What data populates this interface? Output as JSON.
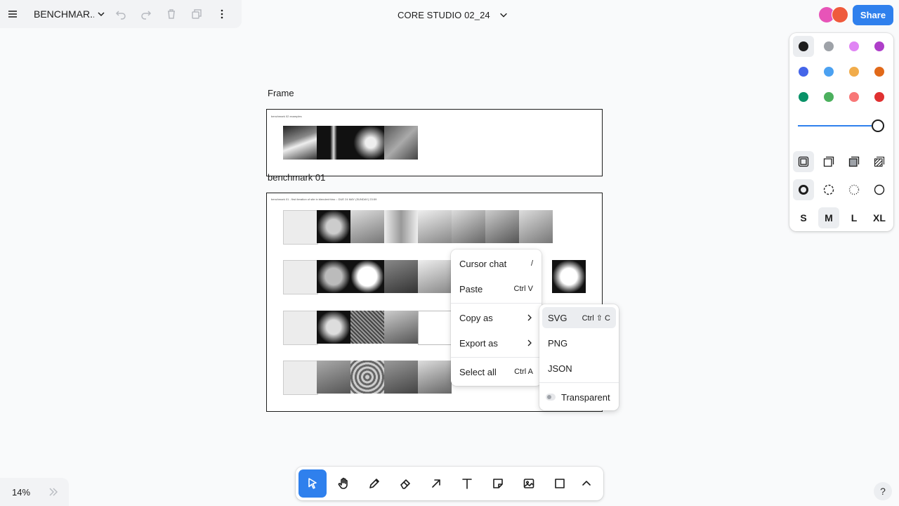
{
  "top_menu": {
    "document_name": "BENCHMAR..."
  },
  "page": {
    "title": "CORE STUDIO 02_24"
  },
  "share": {
    "label": "Share"
  },
  "avatars": [
    {
      "color": "#e754b8"
    },
    {
      "color": "#ef5a3c"
    }
  ],
  "style_panel": {
    "colors": [
      {
        "name": "black",
        "hex": "#1d1d1d"
      },
      {
        "name": "grey",
        "hex": "#9ea2a8"
      },
      {
        "name": "light-violet",
        "hex": "#e085f4"
      },
      {
        "name": "violet",
        "hex": "#ae3ec9"
      },
      {
        "name": "blue",
        "hex": "#4465e9"
      },
      {
        "name": "light-blue",
        "hex": "#4ba1f1"
      },
      {
        "name": "yellow",
        "hex": "#f1ac4b"
      },
      {
        "name": "orange",
        "hex": "#e16919"
      },
      {
        "name": "green",
        "hex": "#099268"
      },
      {
        "name": "light-green",
        "hex": "#4cb05e"
      },
      {
        "name": "light-red",
        "hex": "#f87777"
      },
      {
        "name": "red",
        "hex": "#e03131"
      }
    ],
    "selected_color": "black",
    "opacity": 1.0,
    "fill_options": [
      "fill-none-icon",
      "fill-semi-icon",
      "fill-solid-icon",
      "fill-pattern-icon"
    ],
    "dash_options": [
      "dash-draw-icon",
      "dash-dashed-icon",
      "dash-dotted-icon",
      "dash-solid-icon"
    ],
    "sizes": [
      "S",
      "M",
      "L",
      "XL"
    ],
    "selected_size": "M"
  },
  "canvas": {
    "frame1": {
      "label": "Frame",
      "inner_title": "benchmark 02 examples"
    },
    "frame2": {
      "label": "benchmark 01",
      "inner_title": "benchmark 01 - first iteration of site in blender/rhino :: DUE 24 MAY (SUNDAY) 23:59"
    }
  },
  "context_menu": {
    "items": [
      {
        "label": "Cursor chat",
        "shortcut": "/"
      },
      {
        "label": "Paste",
        "shortcut": "Ctrl V"
      },
      {
        "label": "Copy as",
        "submenu": true
      },
      {
        "label": "Export as",
        "submenu": true
      },
      {
        "label": "Select all",
        "shortcut": "Ctrl A"
      }
    ]
  },
  "submenu": {
    "items": [
      {
        "label": "SVG",
        "shortcut": "Ctrl ⇧ C"
      },
      {
        "label": "PNG"
      },
      {
        "label": "JSON"
      }
    ],
    "transparent_label": "Transparent"
  },
  "toolbar": {
    "tools": [
      "select",
      "hand",
      "draw",
      "eraser",
      "arrow",
      "text",
      "note",
      "asset",
      "rectangle",
      "more"
    ],
    "active": "select"
  },
  "zoom": {
    "level": "14%"
  },
  "help": {
    "label": "?"
  }
}
